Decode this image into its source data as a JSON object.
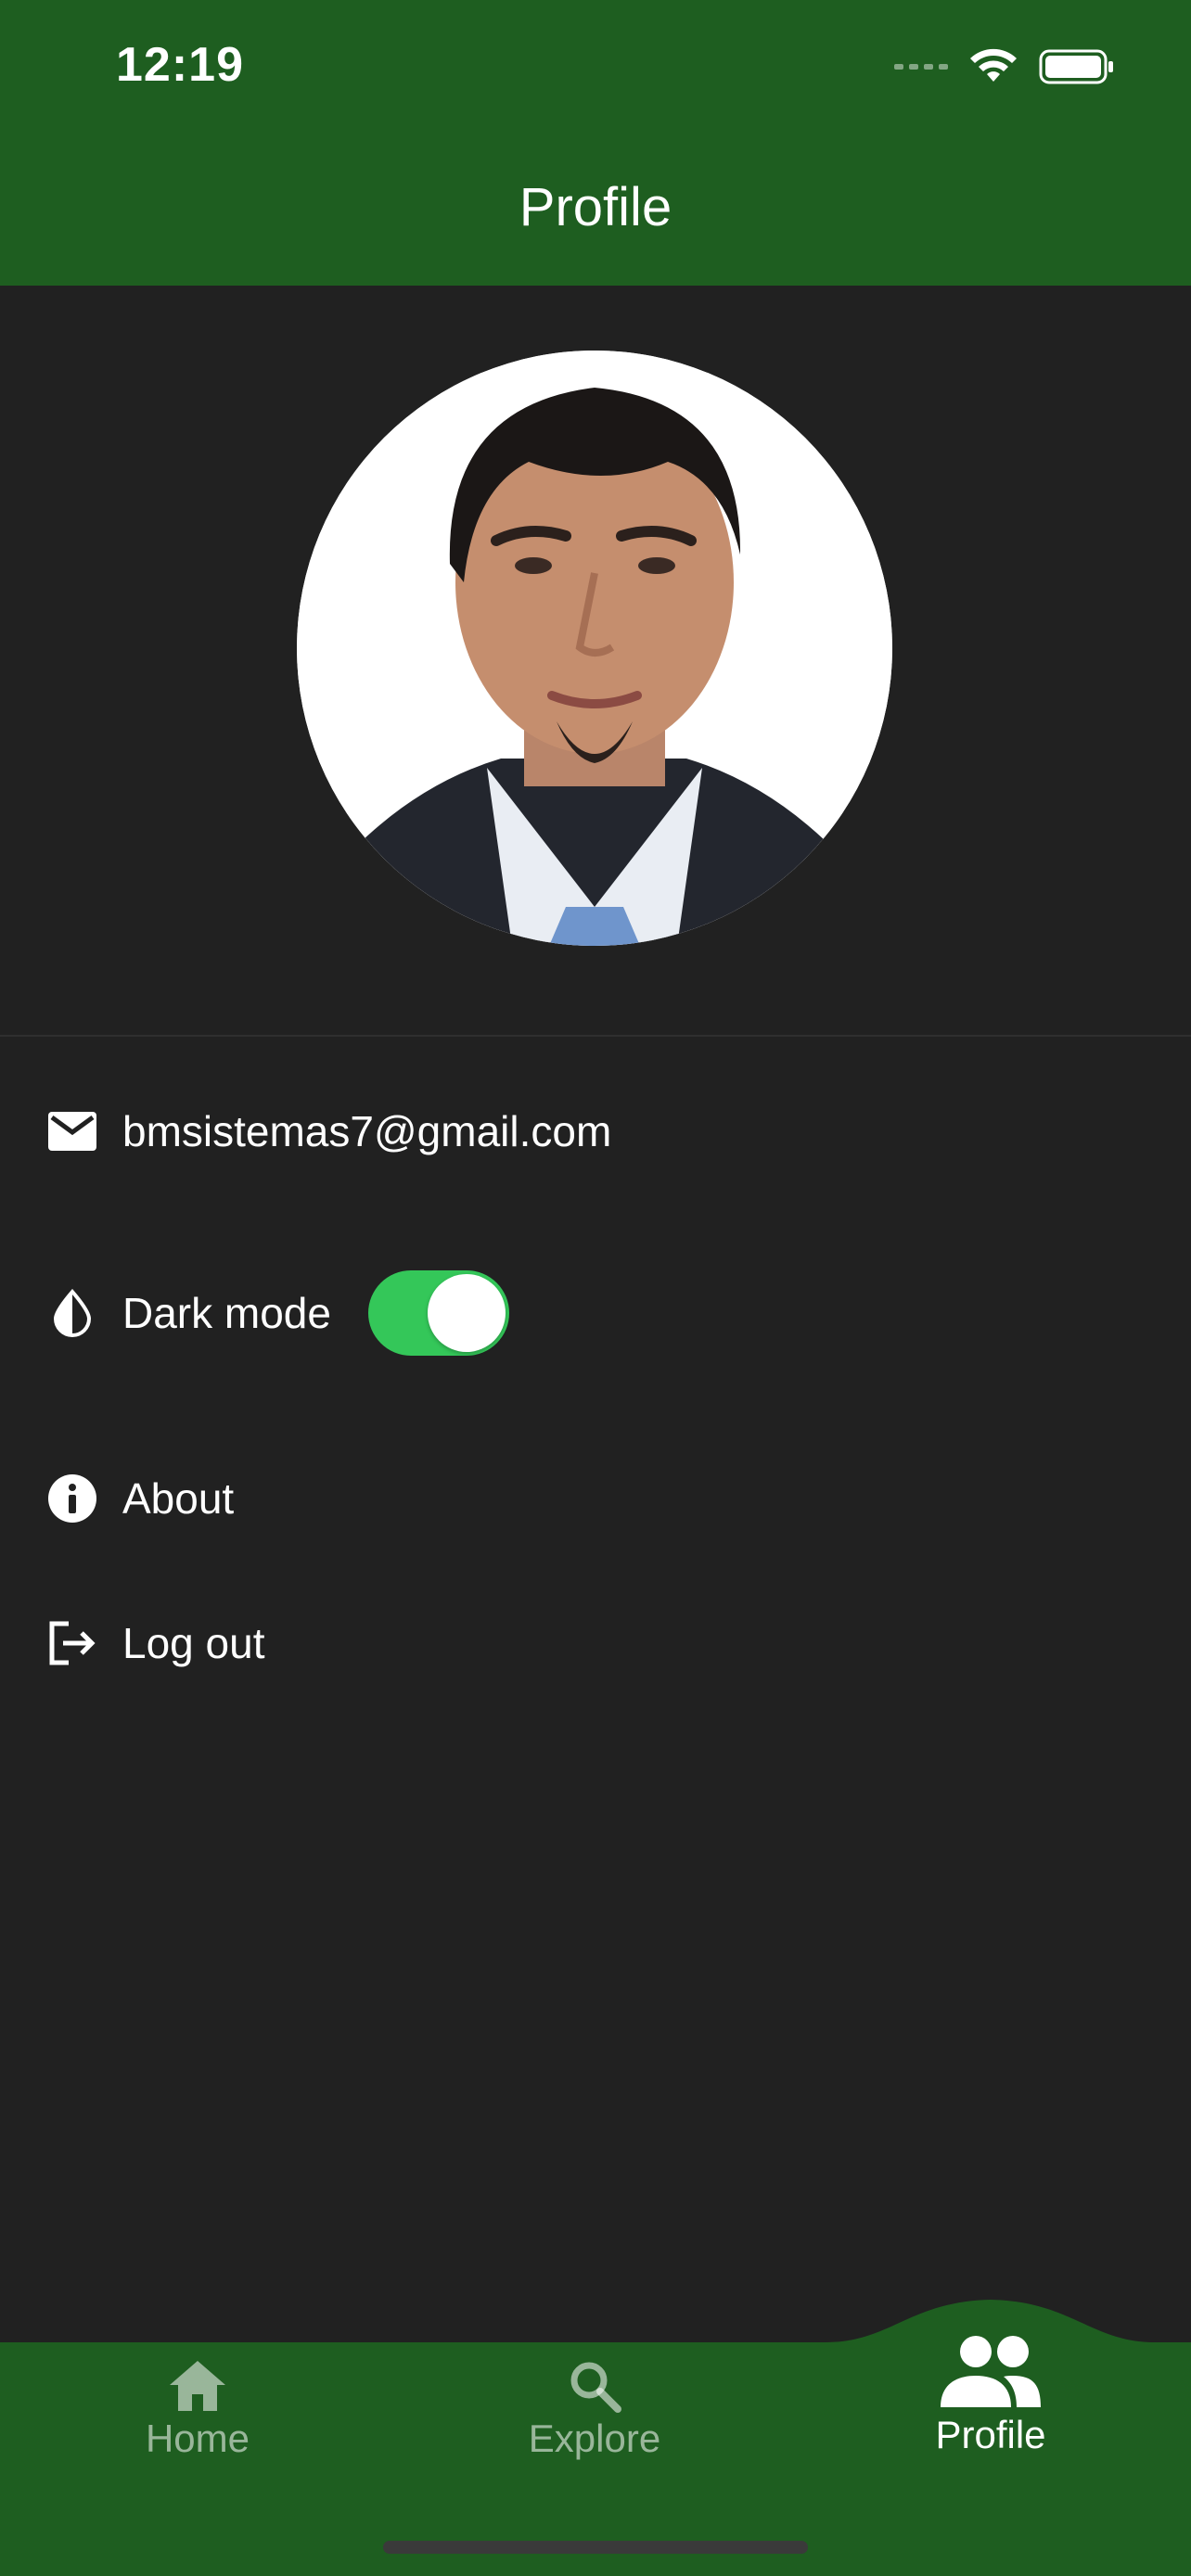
{
  "status_bar": {
    "time": "12:19"
  },
  "header": {
    "title": "Profile"
  },
  "profile": {
    "email": "bmsistemas7@gmail.com",
    "dark_mode_label": "Dark mode",
    "dark_mode_enabled": true,
    "about_label": "About",
    "logout_label": "Log out"
  },
  "bottom_nav": {
    "items": [
      {
        "label": "Home",
        "icon": "home-icon",
        "active": false
      },
      {
        "label": "Explore",
        "icon": "search-icon",
        "active": false
      },
      {
        "label": "Profile",
        "icon": "people-icon",
        "active": true
      }
    ]
  },
  "colors": {
    "header_bg": "#1e5e20",
    "screen_bg": "#212121",
    "toggle_on": "#34c759"
  }
}
